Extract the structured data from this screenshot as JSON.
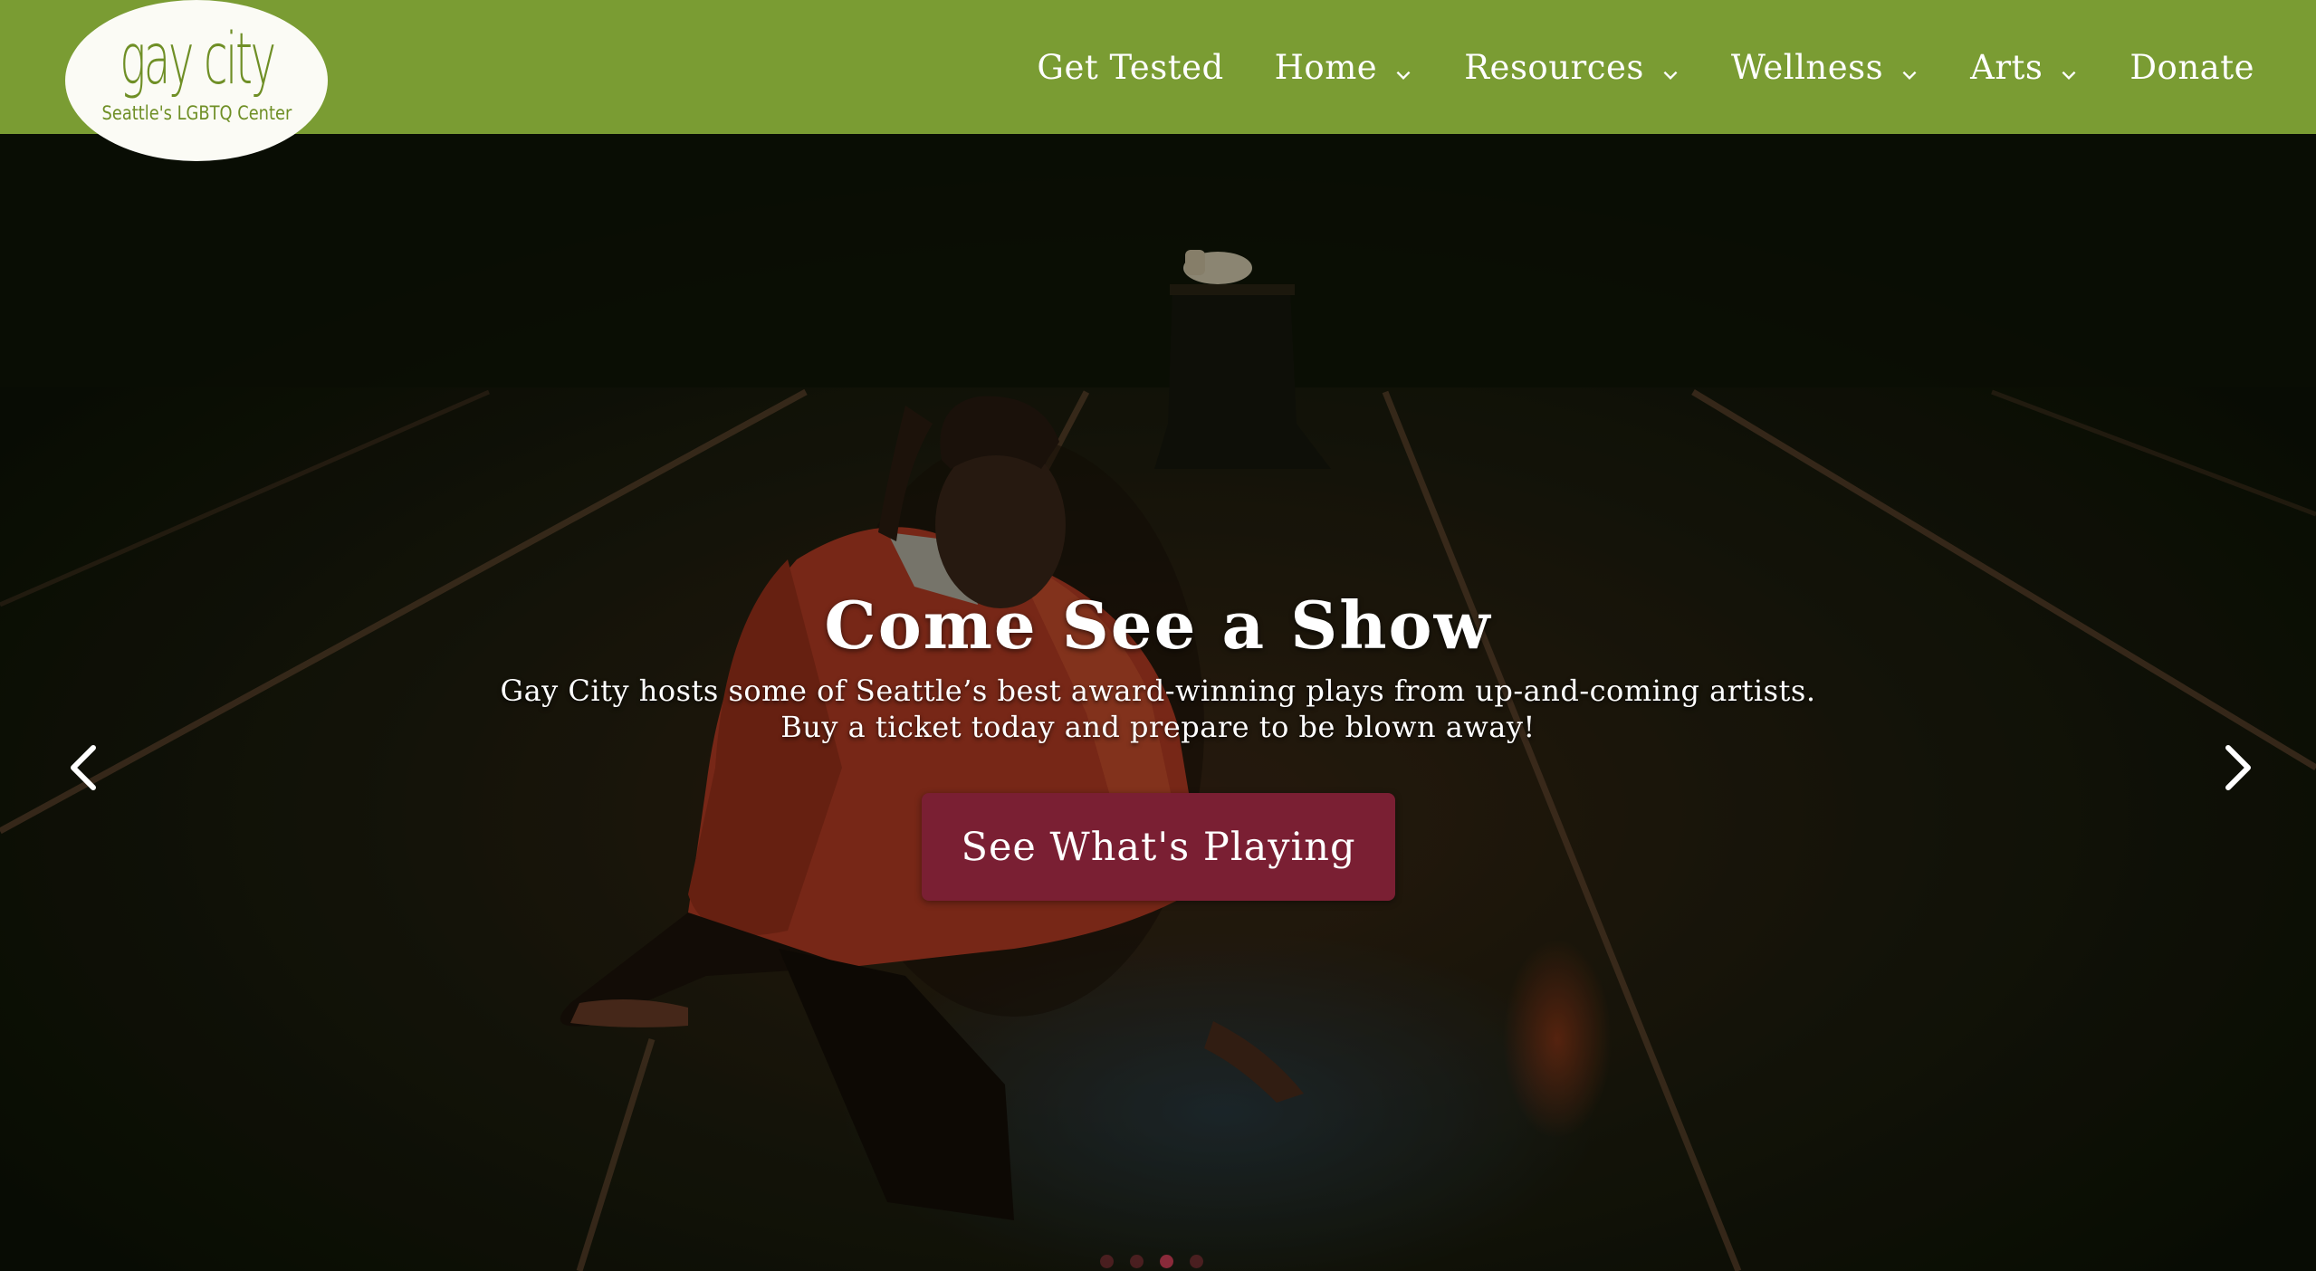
{
  "logo": {
    "wordmark": "gay city",
    "tagline": "Seattle's LGBTQ Center"
  },
  "nav": {
    "items": [
      {
        "label": "Get Tested",
        "has_dropdown": false
      },
      {
        "label": "Home",
        "has_dropdown": true
      },
      {
        "label": "Resources",
        "has_dropdown": true
      },
      {
        "label": "Wellness",
        "has_dropdown": true
      },
      {
        "label": "Arts",
        "has_dropdown": true
      },
      {
        "label": "Donate",
        "has_dropdown": false
      }
    ]
  },
  "hero": {
    "title": "Come See a Show",
    "subtitle_line1": "Gay City hosts some of Seattle’s best award-winning plays from up-and-coming artists.",
    "subtitle_line2": "Buy a ticket today and prepare to be blown away!",
    "cta_label": "See What's Playing",
    "slide_count": 4,
    "active_slide": 3
  },
  "colors": {
    "header_bg": "#7a9c33",
    "logo_green": "#6f8f26",
    "cta_bg": "#7a1f33",
    "text": "#ffffff"
  },
  "icons": {
    "prev": "chevron-left-icon",
    "next": "chevron-right-icon",
    "dropdown": "chevron-down-icon"
  }
}
